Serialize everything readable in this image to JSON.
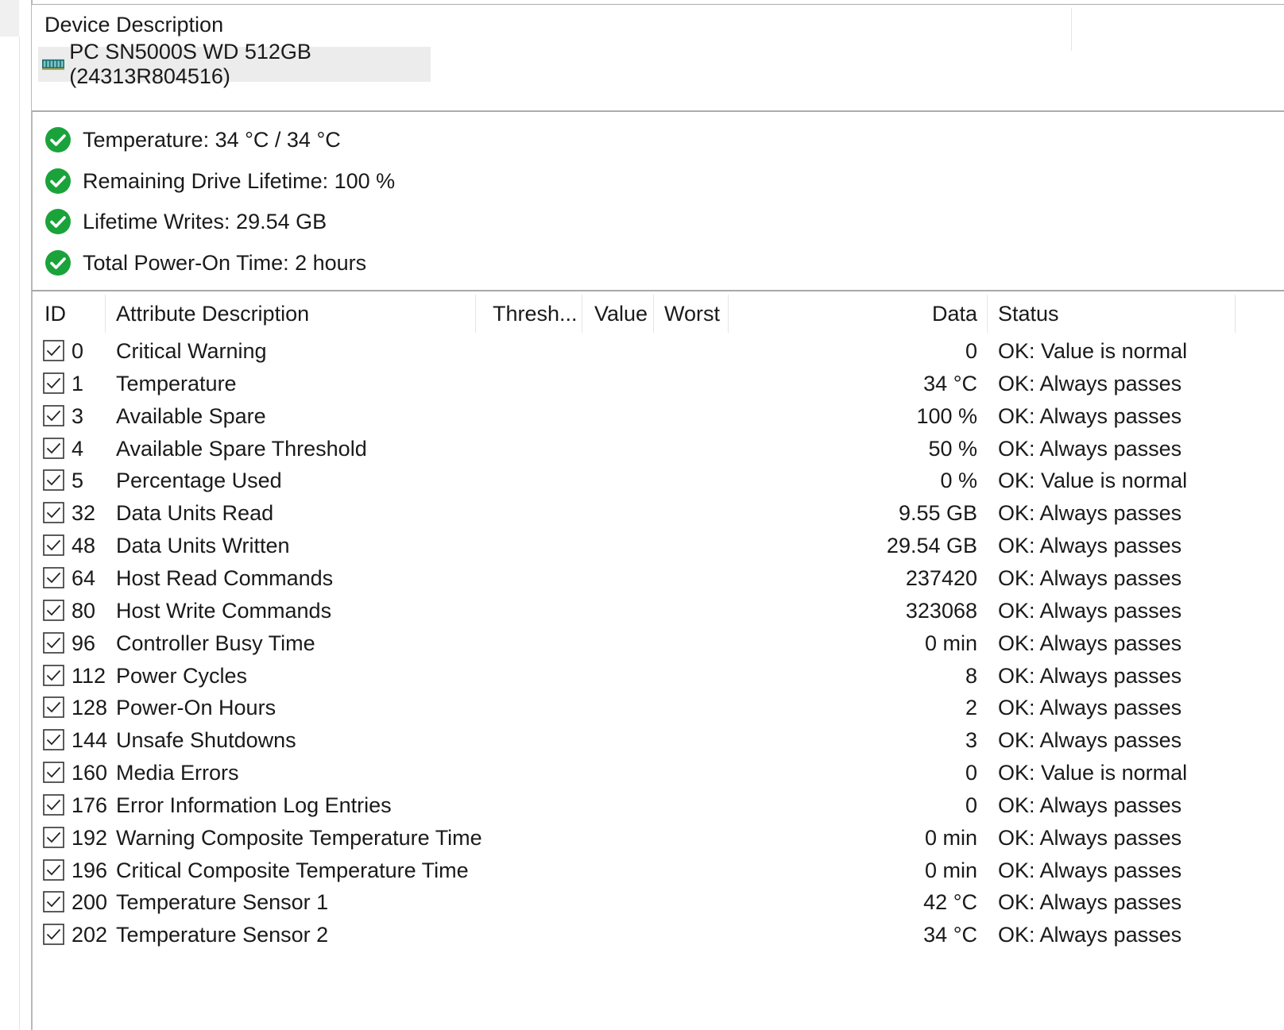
{
  "device": {
    "header": "Device Description",
    "name": "PC SN5000S WD 512GB (24313R804516)",
    "icon": "drive-icon"
  },
  "summary": [
    {
      "text": "Temperature: 34 °C / 34 °C",
      "icon": "check-circle-icon"
    },
    {
      "text": "Remaining Drive Lifetime: 100 %",
      "icon": "check-circle-icon"
    },
    {
      "text": "Lifetime Writes: 29.54 GB",
      "icon": "check-circle-icon"
    },
    {
      "text": "Total Power-On Time: 2 hours",
      "icon": "check-circle-icon"
    }
  ],
  "table": {
    "columns": {
      "id": "ID",
      "description": "Attribute Description",
      "threshold": "Thresh...",
      "value": "Value",
      "worst": "Worst",
      "data": "Data",
      "status": "Status"
    },
    "rows": [
      {
        "id": "0",
        "description": "Critical Warning",
        "data": "0",
        "status": "OK: Value is normal",
        "checked": true
      },
      {
        "id": "1",
        "description": "Temperature",
        "data": "34 °C",
        "status": "OK: Always passes",
        "checked": true
      },
      {
        "id": "3",
        "description": "Available Spare",
        "data": "100 %",
        "status": "OK: Always passes",
        "checked": true
      },
      {
        "id": "4",
        "description": "Available Spare Threshold",
        "data": "50 %",
        "status": "OK: Always passes",
        "checked": true
      },
      {
        "id": "5",
        "description": "Percentage Used",
        "data": "0 %",
        "status": "OK: Value is normal",
        "checked": true
      },
      {
        "id": "32",
        "description": "Data Units Read",
        "data": "9.55 GB",
        "status": "OK: Always passes",
        "checked": true
      },
      {
        "id": "48",
        "description": "Data Units Written",
        "data": "29.54 GB",
        "status": "OK: Always passes",
        "checked": true
      },
      {
        "id": "64",
        "description": "Host Read Commands",
        "data": "237420",
        "status": "OK: Always passes",
        "checked": true
      },
      {
        "id": "80",
        "description": "Host Write Commands",
        "data": "323068",
        "status": "OK: Always passes",
        "checked": true
      },
      {
        "id": "96",
        "description": "Controller Busy Time",
        "data": "0 min",
        "status": "OK: Always passes",
        "checked": true
      },
      {
        "id": "112",
        "description": "Power Cycles",
        "data": "8",
        "status": "OK: Always passes",
        "checked": true
      },
      {
        "id": "128",
        "description": "Power-On Hours",
        "data": "2",
        "status": "OK: Always passes",
        "checked": true
      },
      {
        "id": "144",
        "description": "Unsafe Shutdowns",
        "data": "3",
        "status": "OK: Always passes",
        "checked": true
      },
      {
        "id": "160",
        "description": "Media Errors",
        "data": "0",
        "status": "OK: Value is normal",
        "checked": true
      },
      {
        "id": "176",
        "description": "Error Information Log Entries",
        "data": "0",
        "status": "OK: Always passes",
        "checked": true
      },
      {
        "id": "192",
        "description": "Warning Composite Temperature Time",
        "data": "0 min",
        "status": "OK: Always passes",
        "checked": true
      },
      {
        "id": "196",
        "description": "Critical Composite Temperature Time",
        "data": "0 min",
        "status": "OK: Always passes",
        "checked": true
      },
      {
        "id": "200",
        "description": "Temperature Sensor 1",
        "data": "42 °C",
        "status": "OK: Always passes",
        "checked": true
      },
      {
        "id": "202",
        "description": "Temperature Sensor 2",
        "data": "34 °C",
        "status": "OK: Always passes",
        "checked": true
      }
    ]
  },
  "colors": {
    "ok_green": "#1aa33a",
    "selection_gray": "#ececec",
    "checkbox_border": "#333333",
    "drive_icon": "#1f6f74"
  }
}
